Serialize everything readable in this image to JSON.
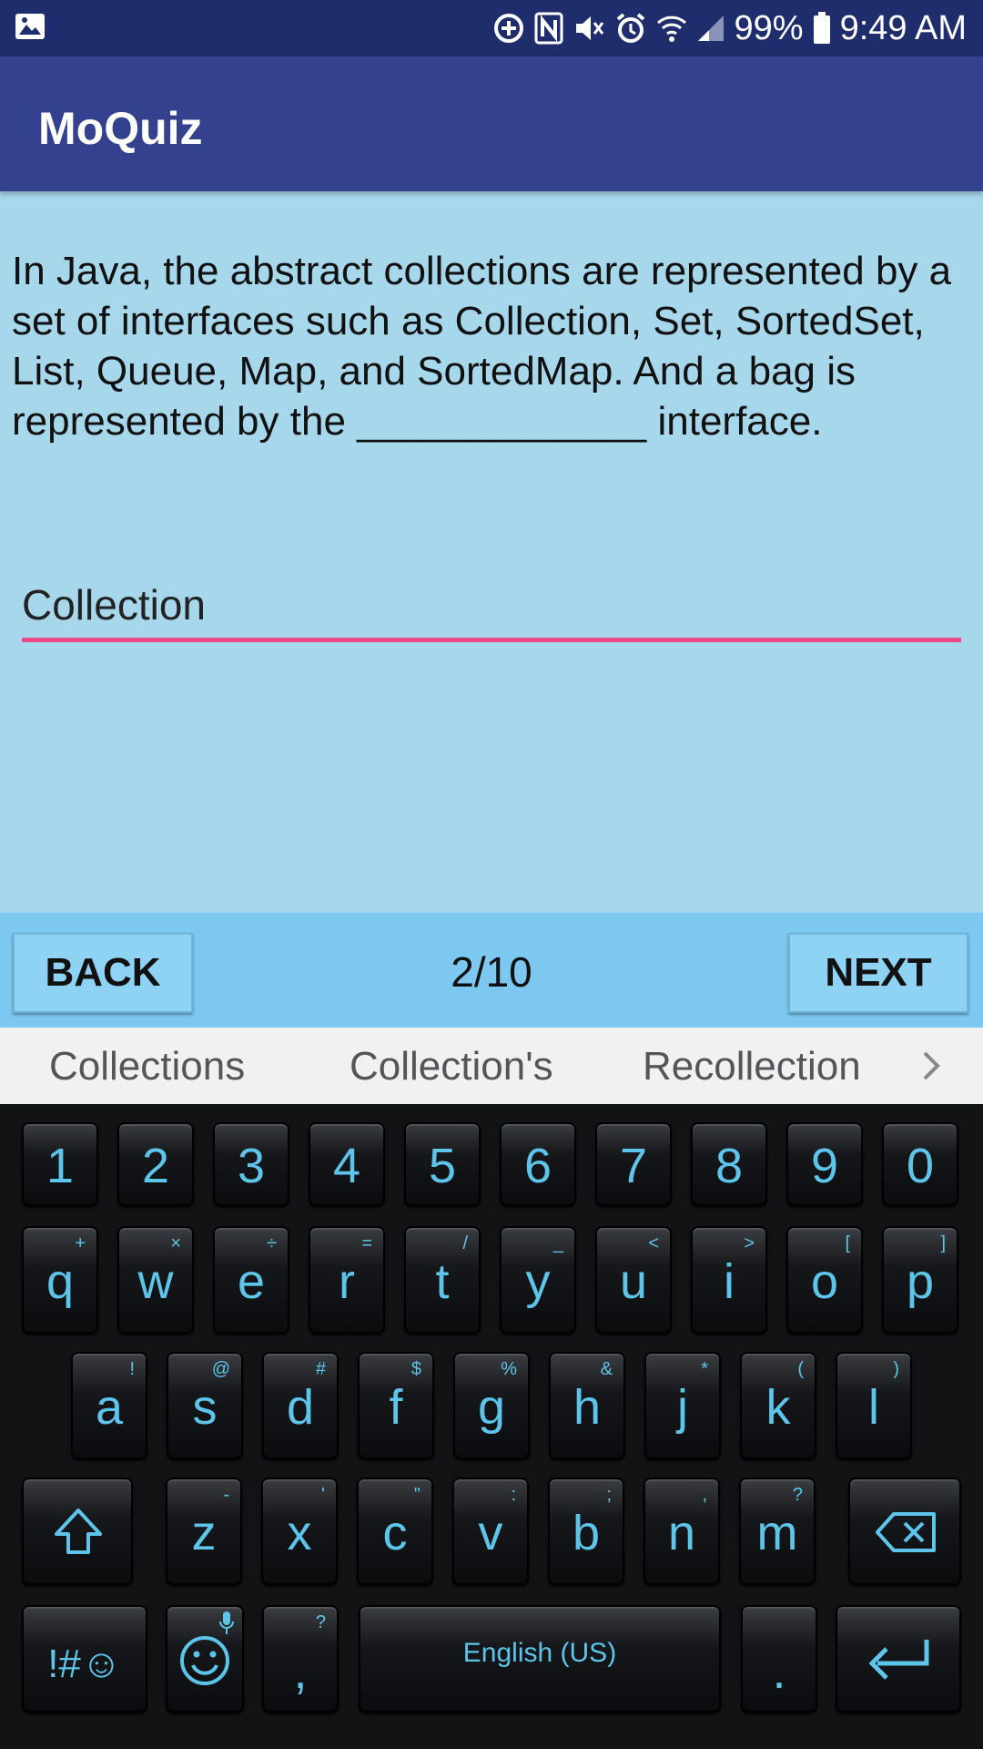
{
  "status_bar": {
    "battery": "99%",
    "time": "9:49 AM",
    "icons": [
      "gallery-icon",
      "data-saver-icon",
      "nfc-icon",
      "mute-icon",
      "alarm-icon",
      "wifi-icon",
      "signal-icon",
      "battery-icon"
    ]
  },
  "app": {
    "title": "MoQuiz"
  },
  "question": {
    "text": "In Java, the abstract collections are represented by a set of interfaces such as Collection, Set, SortedSet, List, Queue, Map, and SortedMap. And a bag is represented by the _____________ interface."
  },
  "answer": {
    "value": "Collection"
  },
  "navigation": {
    "back_label": "BACK",
    "progress": "2/10",
    "next_label": "NEXT"
  },
  "suggestions": [
    "Collections",
    "Collection's",
    "Recollection"
  ],
  "keyboard": {
    "numbers": [
      "1",
      "2",
      "3",
      "4",
      "5",
      "6",
      "7",
      "8",
      "9",
      "0"
    ],
    "row1": [
      {
        "key": "q",
        "hint": "+"
      },
      {
        "key": "w",
        "hint": "×"
      },
      {
        "key": "e",
        "hint": "÷"
      },
      {
        "key": "r",
        "hint": "="
      },
      {
        "key": "t",
        "hint": "/"
      },
      {
        "key": "y",
        "hint": "_"
      },
      {
        "key": "u",
        "hint": "<"
      },
      {
        "key": "i",
        "hint": ">"
      },
      {
        "key": "o",
        "hint": "["
      },
      {
        "key": "p",
        "hint": "]"
      }
    ],
    "row2": [
      {
        "key": "a",
        "hint": "!"
      },
      {
        "key": "s",
        "hint": "@"
      },
      {
        "key": "d",
        "hint": "#"
      },
      {
        "key": "f",
        "hint": "$"
      },
      {
        "key": "g",
        "hint": "%"
      },
      {
        "key": "h",
        "hint": "&"
      },
      {
        "key": "j",
        "hint": "*"
      },
      {
        "key": "k",
        "hint": "("
      },
      {
        "key": "l",
        "hint": ")"
      }
    ],
    "row3": [
      {
        "key": "z",
        "hint": "-"
      },
      {
        "key": "x",
        "hint": "'"
      },
      {
        "key": "c",
        "hint": "\""
      },
      {
        "key": "v",
        "hint": ":"
      },
      {
        "key": "b",
        "hint": ";"
      },
      {
        "key": "n",
        "hint": ","
      },
      {
        "key": "m",
        "hint": "?"
      }
    ],
    "symbols_label": "!#☺",
    "comma": ",",
    "comma_hint": "?",
    "space_label": "English (US)",
    "period": ".",
    "accent_color": "#5ec5ea"
  }
}
